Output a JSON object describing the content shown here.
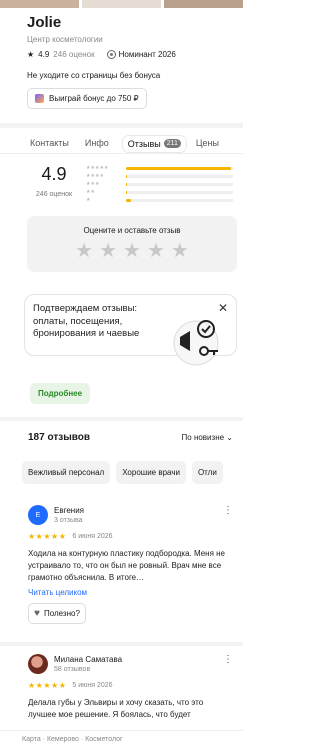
{
  "business": {
    "title": "Jolie",
    "subtitle": "Центр косметологии",
    "rating": "4.9",
    "reviews_count_label": "246 оценок",
    "nominee_label": "Номинант 2026",
    "warning": "Не уходите со страницы без бонуса",
    "bonus_button": "Выиграй бонус до 750 ₽"
  },
  "tabs": [
    {
      "label": "Контакты"
    },
    {
      "label": "Инфо"
    },
    {
      "label": "Отзывы",
      "badge": "211",
      "active": true
    },
    {
      "label": "Цены"
    }
  ],
  "summary": {
    "rating": "4.9",
    "ratings_label": "246 оценок",
    "distribution": [
      0.98,
      0.01,
      0.01,
      0.005,
      0.05
    ]
  },
  "rate_card": {
    "title": "Оцените и оставьте отзыв"
  },
  "promo": {
    "text": "Подтверждаем отзывы: оплаты, посещения, бронирования и чаевые",
    "more_button": "Подробнее"
  },
  "reviews_header": {
    "count": "187 отзывов",
    "sort": "По новизне"
  },
  "chips": [
    "Вежливый персонал",
    "Хорошие врачи",
    "Отли"
  ],
  "reviews": [
    {
      "avatar_letter": "Е",
      "name": "Евгения",
      "sub": "3 отзыва",
      "stars": "★★★★★",
      "date": "6 июня 2026",
      "text": "Ходила на контурную пластику подбородка. Меня не устраивало то, что он был не ровный. Врач мне все грамотно объяснила. В итоге…",
      "read_more": "Читать целиком",
      "useful": "Полезно?"
    },
    {
      "name": "Милана Саматава",
      "sub": "58 отзывов",
      "stars": "★★★★★",
      "date": "5 июня 2026",
      "text": "Делала губы у Эльвиры и хочу сказать, что это лучшее мое решение. Я боялась, что будет"
    }
  ],
  "footer": "Карта · Кемерово · Косметолог"
}
